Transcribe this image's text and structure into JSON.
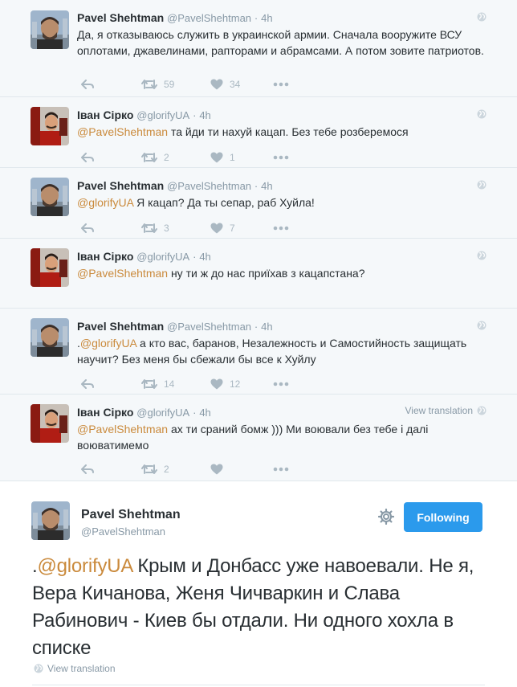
{
  "tweets": [
    {
      "name": "Pavel Shehtman",
      "handle": "@PavelShehtman",
      "time": "4h",
      "mention": "",
      "text": "Да, я отказываюсь служить в украинской армии. Сначала вооружите ВСУ оплотами, джавелинами, рапторами и абрамсами. А потом зовите патриотов.",
      "retweets": "59",
      "likes": "34"
    },
    {
      "name": "Іван Сірко",
      "handle": "@glorifyUA",
      "time": "4h",
      "mention": "@PavelShehtman",
      "text": " та йди ти нахуй кацап. Без тебе розберемося",
      "retweets": "2",
      "likes": "1"
    },
    {
      "name": "Pavel Shehtman",
      "handle": "@PavelShehtman",
      "time": "4h",
      "mention": "@glorifyUA",
      "text": " Я кацап? Да ты сепар, раб Хуйла!",
      "retweets": "3",
      "likes": "7"
    },
    {
      "name": "Іван Сірко",
      "handle": "@glorifyUA",
      "time": "4h",
      "mention": "@PavelShehtman",
      "text": " ну ти ж до нас приїхав з кацапстана?",
      "retweets": "",
      "likes": ""
    },
    {
      "name": "Pavel Shehtman",
      "handle": "@PavelShehtman",
      "time": "4h",
      "prefix": ".",
      "mention": "@glorifyUA",
      "text": " а кто вас, баранов, Незалежность и Самостийность защищать научит? Без меня бы сбежали бы все к Хуйлу",
      "retweets": "14",
      "likes": "12"
    },
    {
      "name": "Іван Сірко",
      "handle": "@glorifyUA",
      "time": "4h",
      "mention": "@PavelShehtman",
      "text": " ах ти сраний бомж ))) Ми воювали без тебе і далі воюватимемо",
      "retweets": "2",
      "likes": "",
      "view_translation": "View translation"
    }
  ],
  "main_tweet": {
    "name": "Pavel Shehtman",
    "handle": "@PavelShehtman",
    "follow_label": "Following",
    "prefix": ".",
    "mention": "@glorifyUA",
    "text": " Крым и Донбасс уже навоевали. Не я, Вера Кичанова, Женя Чичваркин и Слава Рабинович - Киев бы отдали. Ни одного хохла в списке",
    "view_translation": "View translation"
  },
  "colors": {
    "accent": "#2b9aec",
    "mention": "#ca8a3c",
    "muted": "#8899a6",
    "icon": "#aab8c2"
  }
}
